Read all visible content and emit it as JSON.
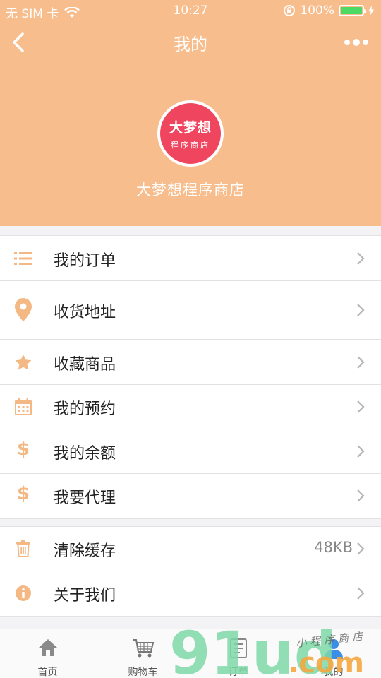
{
  "status_bar": {
    "carrier": "无 SIM 卡",
    "time": "10:27",
    "battery": "100%"
  },
  "nav": {
    "title": "我的"
  },
  "profile": {
    "logo_line1": "大梦想",
    "logo_line2": "程序商店",
    "store_name": "大梦想程序商店"
  },
  "menu": {
    "orders": "我的订单",
    "address": "收货地址",
    "favorites": "收藏商品",
    "appointments": "我的预约",
    "balance": "我的余额",
    "agent": "我要代理"
  },
  "settings": {
    "clear_cache": "清除缓存",
    "cache_size": "48KB",
    "about": "关于我们"
  },
  "tabbar": {
    "home": "首页",
    "cart": "购物车",
    "orders": "订单",
    "mine": "我的"
  },
  "watermark": {
    "brand": "91ud",
    "domain": ".com",
    "tagline": "小程序商店"
  },
  "colors": {
    "header": "#f8bd8c",
    "accent": "#f3b883",
    "logo": "#f0455f",
    "active_tab": "#3a8ee6"
  }
}
